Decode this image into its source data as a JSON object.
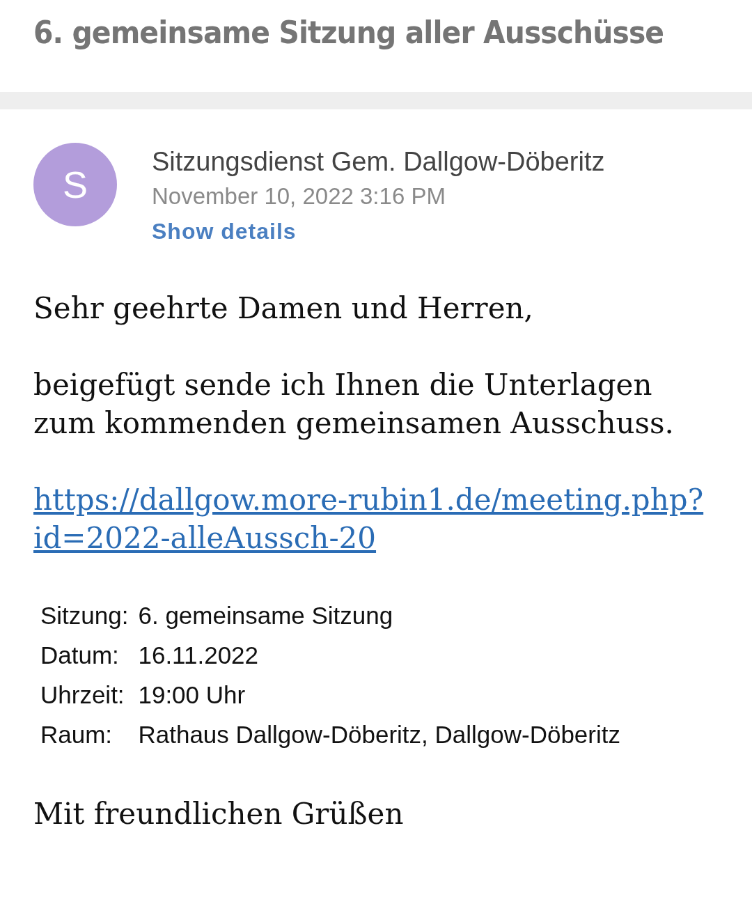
{
  "subject": "6. gemeinsame Sitzung aller Ausschüsse",
  "sender": {
    "avatar_letter": "S",
    "color": "#b39ddb",
    "name": "Sitzungsdienst Gem. Dallgow-Döberitz",
    "date": "November 10, 2022 3:16 PM",
    "details_link": "Show details"
  },
  "body": {
    "greeting": "Sehr geehrte Damen und Herren,",
    "paragraph": "beigefügt sende ich Ihnen die Unterlagen zum kommenden gemeinsamen Ausschuss.",
    "link": "https://dallgow.more-rubin1.de/meeting.php?id=2022-alleAussch-20",
    "details": [
      {
        "label": "Sitzung:",
        "value": "6. gemeinsame Sitzung"
      },
      {
        "label": "Datum:",
        "value": "16.11.2022"
      },
      {
        "label": "Uhrzeit:",
        "value": "19:00 Uhr"
      },
      {
        "label": "Raum:",
        "value": "Rathaus Dallgow-Döberitz, Dallgow-Döberitz"
      }
    ],
    "closing": "Mit freundlichen Grüßen"
  }
}
